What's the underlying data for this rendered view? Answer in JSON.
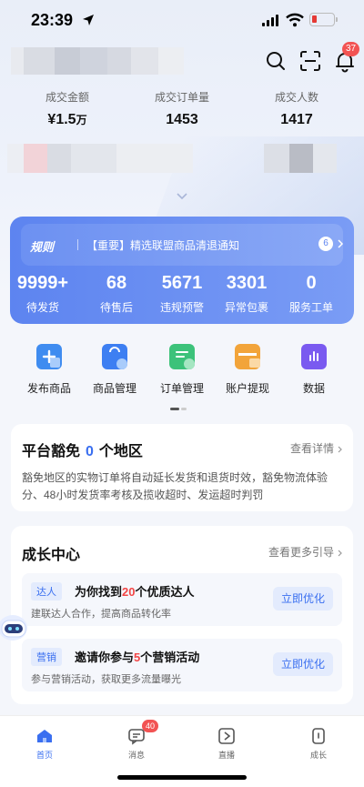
{
  "status_bar": {
    "time": "23:39"
  },
  "header": {
    "notification_count": "37"
  },
  "stats": [
    {
      "label": "成交金额",
      "value": "¥1.5",
      "unit": "万"
    },
    {
      "label": "成交订单量",
      "value": "1453",
      "unit": ""
    },
    {
      "label": "成交人数",
      "value": "1417",
      "unit": ""
    }
  ],
  "rules_card": {
    "tag": "规则",
    "notice": "【重要】精选联盟商品清退通知",
    "notice_count": "6",
    "metrics": [
      {
        "value": "9999+",
        "label": "待发货"
      },
      {
        "value": "68",
        "label": "待售后"
      },
      {
        "value": "5671",
        "label": "违规预警"
      },
      {
        "value": "3301",
        "label": "异常包裹"
      },
      {
        "value": "0",
        "label": "服务工单"
      }
    ]
  },
  "tools": [
    {
      "label": "发布商品",
      "icon": "add-product-icon",
      "color": "#3f8cf0"
    },
    {
      "label": "商品管理",
      "icon": "shopping-bag-icon",
      "color": "#3d7ff2"
    },
    {
      "label": "订单管理",
      "icon": "order-icon",
      "color": "#3cc27a"
    },
    {
      "label": "账户提现",
      "icon": "wallet-icon",
      "color": "#f2a43a"
    },
    {
      "label": "数据",
      "icon": "chart-icon",
      "color": "#7a5af0"
    }
  ],
  "platform": {
    "title_pre": "平台豁免",
    "count": "0",
    "title_post": "个地区",
    "more": "查看详情",
    "desc": "豁免地区的实物订单将自动延长发货和退货时效，豁免物流体验分、48小时发货率考核及揽收超时、发运超时判罚"
  },
  "growth": {
    "title": "成长中心",
    "more": "查看更多引导",
    "items": [
      {
        "tag": "达人",
        "title_pre": "为你找到",
        "title_num": "20",
        "title_post": "个优质达人",
        "sub": "建联达人合作，提高商品转化率",
        "button": "立即优化"
      },
      {
        "tag": "营销",
        "title_pre": "邀请你参与",
        "title_num": "5",
        "title_post": "个营销活动",
        "sub": "参与营销活动，获取更多流量曝光",
        "button": "立即优化"
      }
    ]
  },
  "tabbar": {
    "tabs": [
      {
        "label": "首页",
        "icon": "home-icon"
      },
      {
        "label": "消息",
        "icon": "message-icon"
      },
      {
        "label": "直播",
        "icon": "live-icon"
      },
      {
        "label": "成长",
        "icon": "growth-icon"
      }
    ],
    "message_badge": "40"
  },
  "colors": {
    "accent": "#3a6ff0",
    "badge": "#f25353",
    "card_blue": "#5d84f0"
  }
}
